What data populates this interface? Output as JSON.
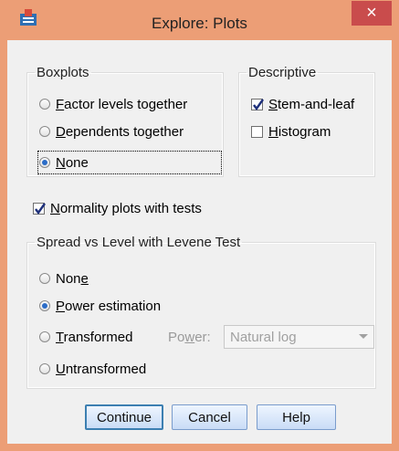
{
  "window": {
    "title": "Explore: Plots",
    "close_glyph": "×",
    "app_icon": "spss-icon"
  },
  "boxplots": {
    "legend": "Boxplots",
    "options": [
      {
        "pre": "",
        "key": "F",
        "rest": "actor levels together",
        "selected": false
      },
      {
        "pre": "",
        "key": "D",
        "rest": "ependents together",
        "selected": false
      },
      {
        "pre": "",
        "key": "N",
        "rest": "one",
        "selected": true
      }
    ]
  },
  "descriptive": {
    "legend": "Descriptive",
    "stem": {
      "pre": "",
      "key": "S",
      "rest": "tem-and-leaf",
      "checked": true
    },
    "hist": {
      "pre": "",
      "key": "H",
      "rest": "istogram",
      "checked": false
    }
  },
  "normality": {
    "pre": "",
    "key": "N",
    "rest": "ormality plots with tests",
    "checked": true
  },
  "spread": {
    "legend": "Spread vs Level with Levene Test",
    "none": {
      "pre": "Non",
      "key": "e",
      "rest": ""
    },
    "power": {
      "pre": "",
      "key": "P",
      "rest": "ower estimation"
    },
    "transformed": {
      "pre": "",
      "key": "T",
      "rest": "ransformed"
    },
    "untransformed": {
      "pre": "",
      "key": "U",
      "rest": "ntransformed"
    },
    "power_label": {
      "pre": "Po",
      "key": "w",
      "rest": "er:"
    },
    "power_value": "Natural log",
    "selected": "power"
  },
  "buttons": {
    "continue": "Continue",
    "cancel": "Cancel",
    "help": "Help"
  },
  "colors": {
    "frame": "#ec9e76",
    "close": "#c94c4c",
    "accent": "#2b6cc7"
  }
}
